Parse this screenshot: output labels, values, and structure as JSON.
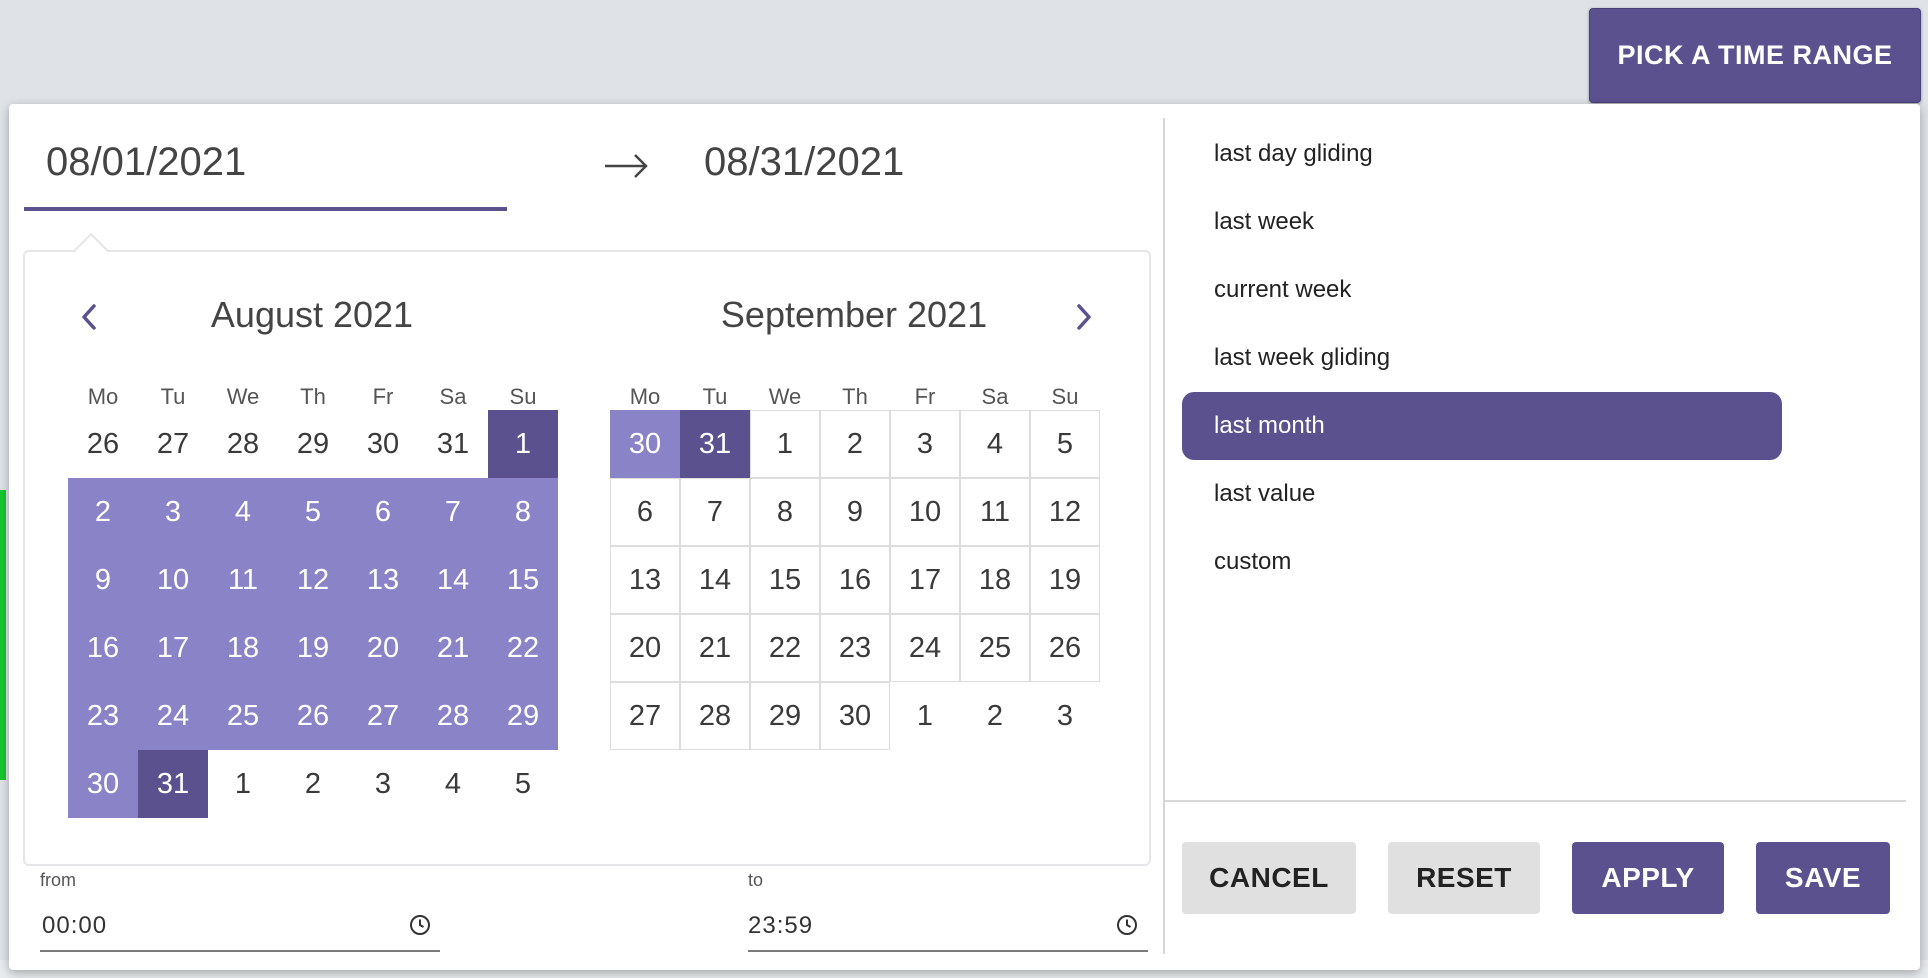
{
  "header": {
    "pick_button_label": "PICK A TIME RANGE"
  },
  "range": {
    "start": "08/01/2021",
    "end": "08/31/2021"
  },
  "calendar": {
    "dow": [
      "Mo",
      "Tu",
      "We",
      "Th",
      "Fr",
      "Sa",
      "Su"
    ],
    "months": [
      {
        "title": "August 2021",
        "days": [
          {
            "d": "26",
            "s": "other"
          },
          {
            "d": "27",
            "s": "other"
          },
          {
            "d": "28",
            "s": "other"
          },
          {
            "d": "29",
            "s": "other"
          },
          {
            "d": "30",
            "s": "other"
          },
          {
            "d": "31",
            "s": "other"
          },
          {
            "d": "1",
            "s": "edge"
          },
          {
            "d": "2",
            "s": "inrange"
          },
          {
            "d": "3",
            "s": "inrange"
          },
          {
            "d": "4",
            "s": "inrange"
          },
          {
            "d": "5",
            "s": "inrange"
          },
          {
            "d": "6",
            "s": "inrange"
          },
          {
            "d": "7",
            "s": "inrange"
          },
          {
            "d": "8",
            "s": "inrange"
          },
          {
            "d": "9",
            "s": "inrange"
          },
          {
            "d": "10",
            "s": "inrange"
          },
          {
            "d": "11",
            "s": "inrange"
          },
          {
            "d": "12",
            "s": "inrange"
          },
          {
            "d": "13",
            "s": "inrange"
          },
          {
            "d": "14",
            "s": "inrange"
          },
          {
            "d": "15",
            "s": "inrange"
          },
          {
            "d": "16",
            "s": "inrange"
          },
          {
            "d": "17",
            "s": "inrange"
          },
          {
            "d": "18",
            "s": "inrange"
          },
          {
            "d": "19",
            "s": "inrange"
          },
          {
            "d": "20",
            "s": "inrange"
          },
          {
            "d": "21",
            "s": "inrange"
          },
          {
            "d": "22",
            "s": "inrange"
          },
          {
            "d": "23",
            "s": "inrange"
          },
          {
            "d": "24",
            "s": "inrange"
          },
          {
            "d": "25",
            "s": "inrange"
          },
          {
            "d": "26",
            "s": "inrange"
          },
          {
            "d": "27",
            "s": "inrange"
          },
          {
            "d": "28",
            "s": "inrange"
          },
          {
            "d": "29",
            "s": "inrange"
          },
          {
            "d": "30",
            "s": "inrange"
          },
          {
            "d": "31",
            "s": "edge"
          },
          {
            "d": "1",
            "s": "other"
          },
          {
            "d": "2",
            "s": "other"
          },
          {
            "d": "3",
            "s": "other"
          },
          {
            "d": "4",
            "s": "other"
          },
          {
            "d": "5",
            "s": "other"
          }
        ]
      },
      {
        "title": "September 2021",
        "days": [
          {
            "d": "30",
            "s": "inrange"
          },
          {
            "d": "31",
            "s": "edge"
          },
          {
            "d": "1",
            "s": "cur"
          },
          {
            "d": "2",
            "s": "cur"
          },
          {
            "d": "3",
            "s": "cur"
          },
          {
            "d": "4",
            "s": "cur"
          },
          {
            "d": "5",
            "s": "cur"
          },
          {
            "d": "6",
            "s": "cur"
          },
          {
            "d": "7",
            "s": "cur"
          },
          {
            "d": "8",
            "s": "cur"
          },
          {
            "d": "9",
            "s": "cur"
          },
          {
            "d": "10",
            "s": "cur"
          },
          {
            "d": "11",
            "s": "cur"
          },
          {
            "d": "12",
            "s": "cur"
          },
          {
            "d": "13",
            "s": "cur"
          },
          {
            "d": "14",
            "s": "cur"
          },
          {
            "d": "15",
            "s": "cur"
          },
          {
            "d": "16",
            "s": "cur"
          },
          {
            "d": "17",
            "s": "cur"
          },
          {
            "d": "18",
            "s": "cur"
          },
          {
            "d": "19",
            "s": "cur"
          },
          {
            "d": "20",
            "s": "cur"
          },
          {
            "d": "21",
            "s": "cur"
          },
          {
            "d": "22",
            "s": "cur"
          },
          {
            "d": "23",
            "s": "cur"
          },
          {
            "d": "24",
            "s": "cur"
          },
          {
            "d": "25",
            "s": "cur"
          },
          {
            "d": "26",
            "s": "cur"
          },
          {
            "d": "27",
            "s": "cur"
          },
          {
            "d": "28",
            "s": "cur"
          },
          {
            "d": "29",
            "s": "cur"
          },
          {
            "d": "30",
            "s": "cur"
          },
          {
            "d": "1",
            "s": "other"
          },
          {
            "d": "2",
            "s": "other"
          },
          {
            "d": "3",
            "s": "other"
          }
        ]
      }
    ]
  },
  "time": {
    "from_label": "from",
    "from_value": "00:00",
    "to_label": "to",
    "to_value": "23:59"
  },
  "presets": [
    "last day gliding",
    "last week",
    "current week",
    "last week gliding",
    "last month",
    "last value",
    "custom"
  ],
  "selected_preset": "last month",
  "actions": {
    "cancel": "CANCEL",
    "reset": "RESET",
    "apply": "APPLY",
    "save": "SAVE"
  },
  "colors": {
    "primary": "#5c518f",
    "range": "#8b83c7",
    "secondary_btn": "#e0e0e0"
  },
  "icons": {
    "prev": "chevron-left-icon",
    "next": "chevron-right-icon",
    "arrow": "arrow-right-icon",
    "clock": "clock-icon"
  }
}
